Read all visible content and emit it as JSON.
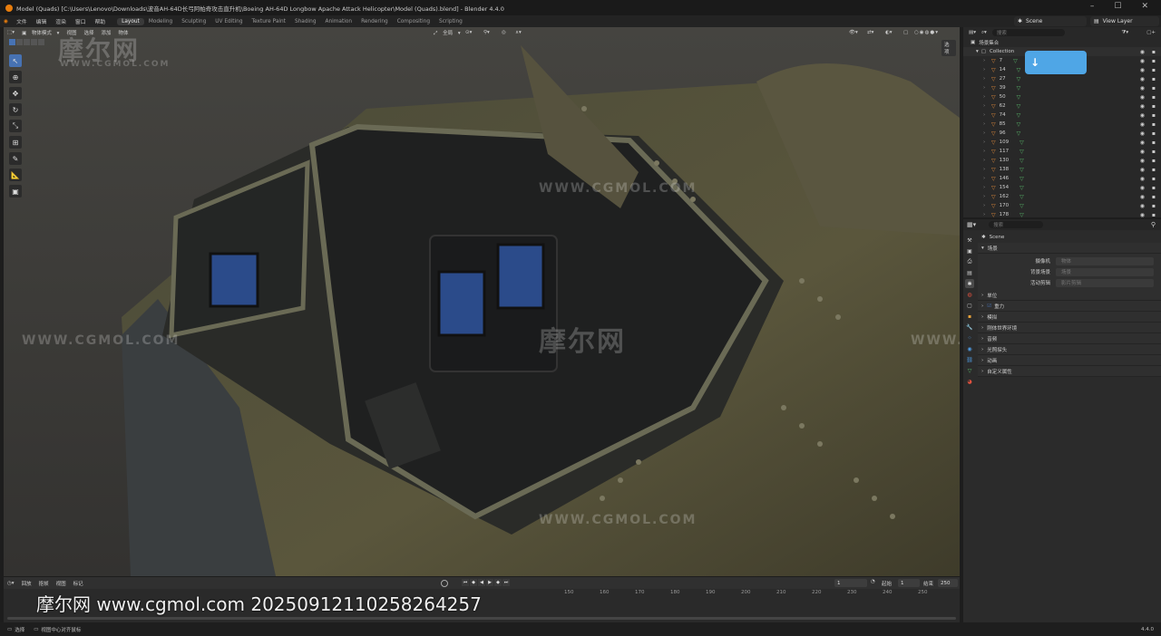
{
  "window": {
    "title": "Model (Quads) [C:\\Users\\Lenovo\\Downloads\\波音AH-64D长弓阿帕奇攻击直升机\\Boeing AH-64D Longbow Apache Attack Helicopter\\Model (Quads).blend] - Blender 4.4.0"
  },
  "menu": {
    "items": [
      "文件",
      "编辑",
      "渲染",
      "窗口",
      "帮助"
    ],
    "workspaces": [
      "Layout",
      "Modeling",
      "Sculpting",
      "UV Editing",
      "Texture Paint",
      "Shading",
      "Animation",
      "Rendering",
      "Compositing",
      "Scripting"
    ],
    "active_workspace": "Layout",
    "scene": "Scene",
    "view_layer": "View Layer"
  },
  "viewport": {
    "mode": "物体模式",
    "menus": [
      "视图",
      "选择",
      "添加",
      "物体"
    ],
    "transform": "全局",
    "options": "选项",
    "watermarks": [
      "摩尔网",
      "WWW.CGMOL.COM"
    ]
  },
  "timeline": {
    "menus": [
      "回放",
      "抠帧",
      "视图",
      "标记"
    ],
    "current_frame": "1",
    "start_label": "起始",
    "start": "1",
    "end_label": "结束",
    "end": "250",
    "ruler": [
      "150",
      "160",
      "170",
      "180",
      "190",
      "200",
      "210",
      "220",
      "230",
      "240",
      "250"
    ]
  },
  "overlay_text": "摩尔网 www.cgmol.com 20250912110258264257",
  "statusbar": {
    "select": "选择",
    "center": "视图中心对齐鼠标",
    "version": "4.4.0"
  },
  "outliner": {
    "header": "场景集合",
    "collection": "Collection",
    "items": [
      "7",
      "14",
      "27",
      "39",
      "50",
      "62",
      "74",
      "85",
      "96",
      "109",
      "117",
      "130",
      "138",
      "146",
      "154",
      "162",
      "170",
      "178"
    ],
    "search_placeholder": "搜索"
  },
  "properties": {
    "search_placeholder": "搜索",
    "breadcrumb": "Scene",
    "section_scene": "场景",
    "rows": [
      {
        "label": "摄像机",
        "value": "物体"
      },
      {
        "label": "背景场景",
        "value": "场景"
      },
      {
        "label": "活动剪辑",
        "value": "影片剪辑"
      }
    ],
    "sections": [
      "单位",
      "重力",
      "模拟",
      "刚体世界环境",
      "音频",
      "光照探头",
      "动画",
      "自定义属性"
    ]
  }
}
